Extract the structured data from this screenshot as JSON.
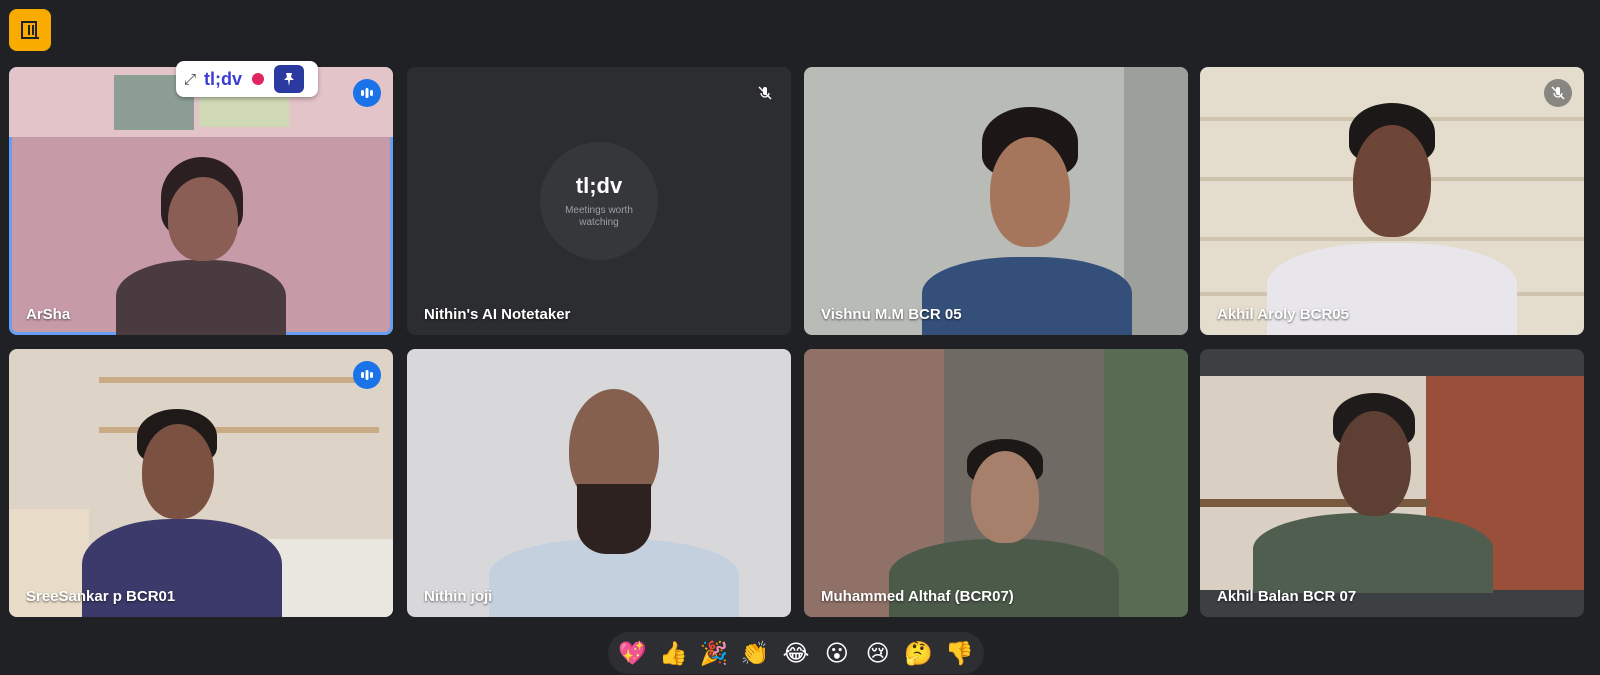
{
  "participants": [
    {
      "name": "ArSha",
      "status": "speaking"
    },
    {
      "name": "Nithin's AI Notetaker",
      "status": "muted"
    },
    {
      "name": "Vishnu M.M BCR 05",
      "status": "none"
    },
    {
      "name": "Akhil Aroly BCR05",
      "status": "muted"
    },
    {
      "name": "SreeSankar p BCR01",
      "status": "speaking"
    },
    {
      "name": "Nithin joji",
      "status": "none"
    },
    {
      "name": "Muhammed Althaf (BCR07)",
      "status": "none"
    },
    {
      "name": "Akhil Balan BCR 07",
      "status": "none"
    }
  ],
  "notetaker": {
    "logo_text": "tl;dv",
    "tagline": "Meetings worth watching"
  },
  "extension_badge": {
    "brand": "tl;dv",
    "expand_icon": "expand-icon",
    "recording_icon": "recording-dot-icon",
    "pin_icon": "pin-sparkle-icon"
  },
  "top_button_icon": "exit-door-icon",
  "reactions": [
    "💖",
    "👍",
    "🎉",
    "👏",
    "😂",
    "😮",
    "😢",
    "🤔",
    "👎"
  ],
  "colors": {
    "background": "#202124",
    "accent_blue": "#1a73e8",
    "active_border": "#669df6",
    "top_button": "#f9ab00",
    "recording": "#e0245e"
  }
}
